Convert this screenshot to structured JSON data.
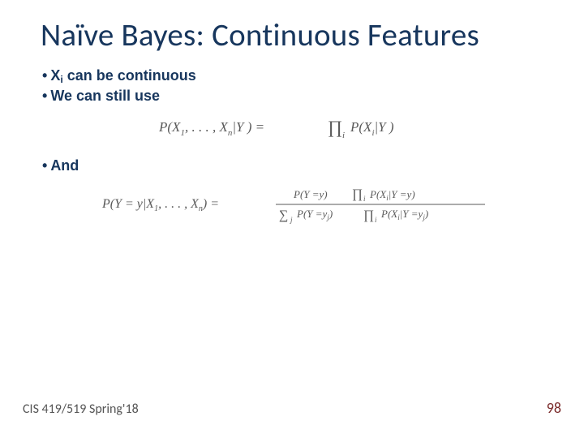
{
  "title": "Naïve Bayes: Continuous Features",
  "bullets": {
    "b1_pre": "X",
    "b1_sub": "i",
    "b1_post": " can be continuous",
    "b2": "We can still use",
    "b3": "And"
  },
  "formula1": {
    "left": "P(X",
    "x1sub": "1",
    "dots": ", . . . , X",
    "xnsub": "n",
    "mid": "|Y ) = ",
    "prod": "∏",
    "prodsub": "i",
    "right": " P(X",
    "xisub": "i",
    "end": "|Y )"
  },
  "formula2": {
    "lhs_pre": "P(Y = y|X",
    "lhs_x1sub": "1",
    "lhs_dots": ", . . . , X",
    "lhs_xnsub": "n",
    "lhs_post": ") = ",
    "num_a": "P(Y =y) ",
    "num_prod": "∏",
    "num_prodsub": "i",
    "num_b": " P(X",
    "num_xisub": "i",
    "num_c": "|Y =y)",
    "den_sum": "∑",
    "den_sumsub": "j",
    "den_a": " P(Y =y",
    "den_yjsub": "j",
    "den_b": ") ",
    "den_prod": "∏",
    "den_prodsub": "i",
    "den_c": " P(X",
    "den_xisub": "i",
    "den_d": "|Y =y",
    "den_yjsub2": "j",
    "den_e": ")"
  },
  "footer": {
    "left": "CIS 419/519 Spring'18",
    "right": "98"
  }
}
